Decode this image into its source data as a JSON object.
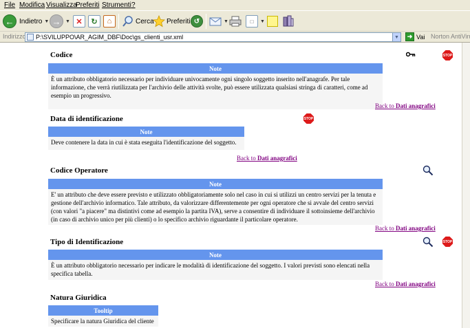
{
  "menu": [
    "File",
    "Modifica",
    "Visualizza",
    "Preferiti",
    "Strumenti",
    "?"
  ],
  "toolbar": {
    "back_label": "Indietro",
    "search_label": "Cerca",
    "favorites_label": "Preferiti"
  },
  "address": {
    "label": "Indirizzo",
    "value": "P:\\SVILUPPO\\AR_AGIM_DBF\\Doc\\gs_clienti_usr.xml",
    "go_label": "Vai",
    "norton_label": "Norton AntiVirus"
  },
  "sections": [
    {
      "title": "Codice",
      "table_header": "Note",
      "body": "È un attributo obbligatorio necessario per individuare univocamente ogni singolo soggetto inserito nell'anagrafe. Per tale informazione, che verrà riutilizzata per l'archivio delle attività svolte, può essere utilizzata qualsiasi stringa di caratteri, come ad esempio un progressivo.",
      "back_prefix": "Back to ",
      "back_target": "Dati anagrafici",
      "icons": [
        "key-icon",
        "stop-icon"
      ]
    },
    {
      "title": "Data di identificazione",
      "table_header": "Note",
      "body": "Deve contenere la data in cui è stata eseguita l'identificazione del soggetto.",
      "back_prefix": "Back to ",
      "back_target": "Dati anagrafici",
      "icons": [
        "stop-icon"
      ]
    },
    {
      "title": "Codice Operatore",
      "table_header": "Note",
      "body": "E' un attributo che deve essere previsto e utilizzato obbligatoriamente solo nel caso in cui si utilizzi un centro servizi per la tenuta e gestione dell'archivio informatico. Tale attributo, da valorizzare differentemente per ogni operatore che si avvale del centro servizi (con valori \"a piacere\" ma distintivi come ad esempio la partita IVA), serve a consentire di individuare il sottoinsieme dell'archivio (in caso di archivio unico per più clienti) o lo specifico archivio riguardante il particolare operatore.",
      "back_prefix": "Back to ",
      "back_target": "Dati anagrafici",
      "icons": [
        "magnifier-icon"
      ]
    },
    {
      "title": "Tipo di Identificazione",
      "table_header": "Note",
      "body": "È un attributo obbligatorio necessario per indicare le modalità di identificazione del soggetto. I valori previsti sono elencati nella specifica tabella.",
      "back_prefix": "Back to ",
      "back_target": "Dati anagrafici",
      "icons": [
        "magnifier-icon",
        "stop-icon"
      ]
    },
    {
      "title": "Natura Giuridica",
      "table_header": "Tooltip",
      "body": "Specificare la natura Giuridica del cliente"
    }
  ],
  "stop_text": "STOP",
  "colors": {
    "table_header": "#6495ed",
    "table_body": "#f5f5f5",
    "link_visited": "#800080",
    "chrome": "#ece9d8"
  }
}
